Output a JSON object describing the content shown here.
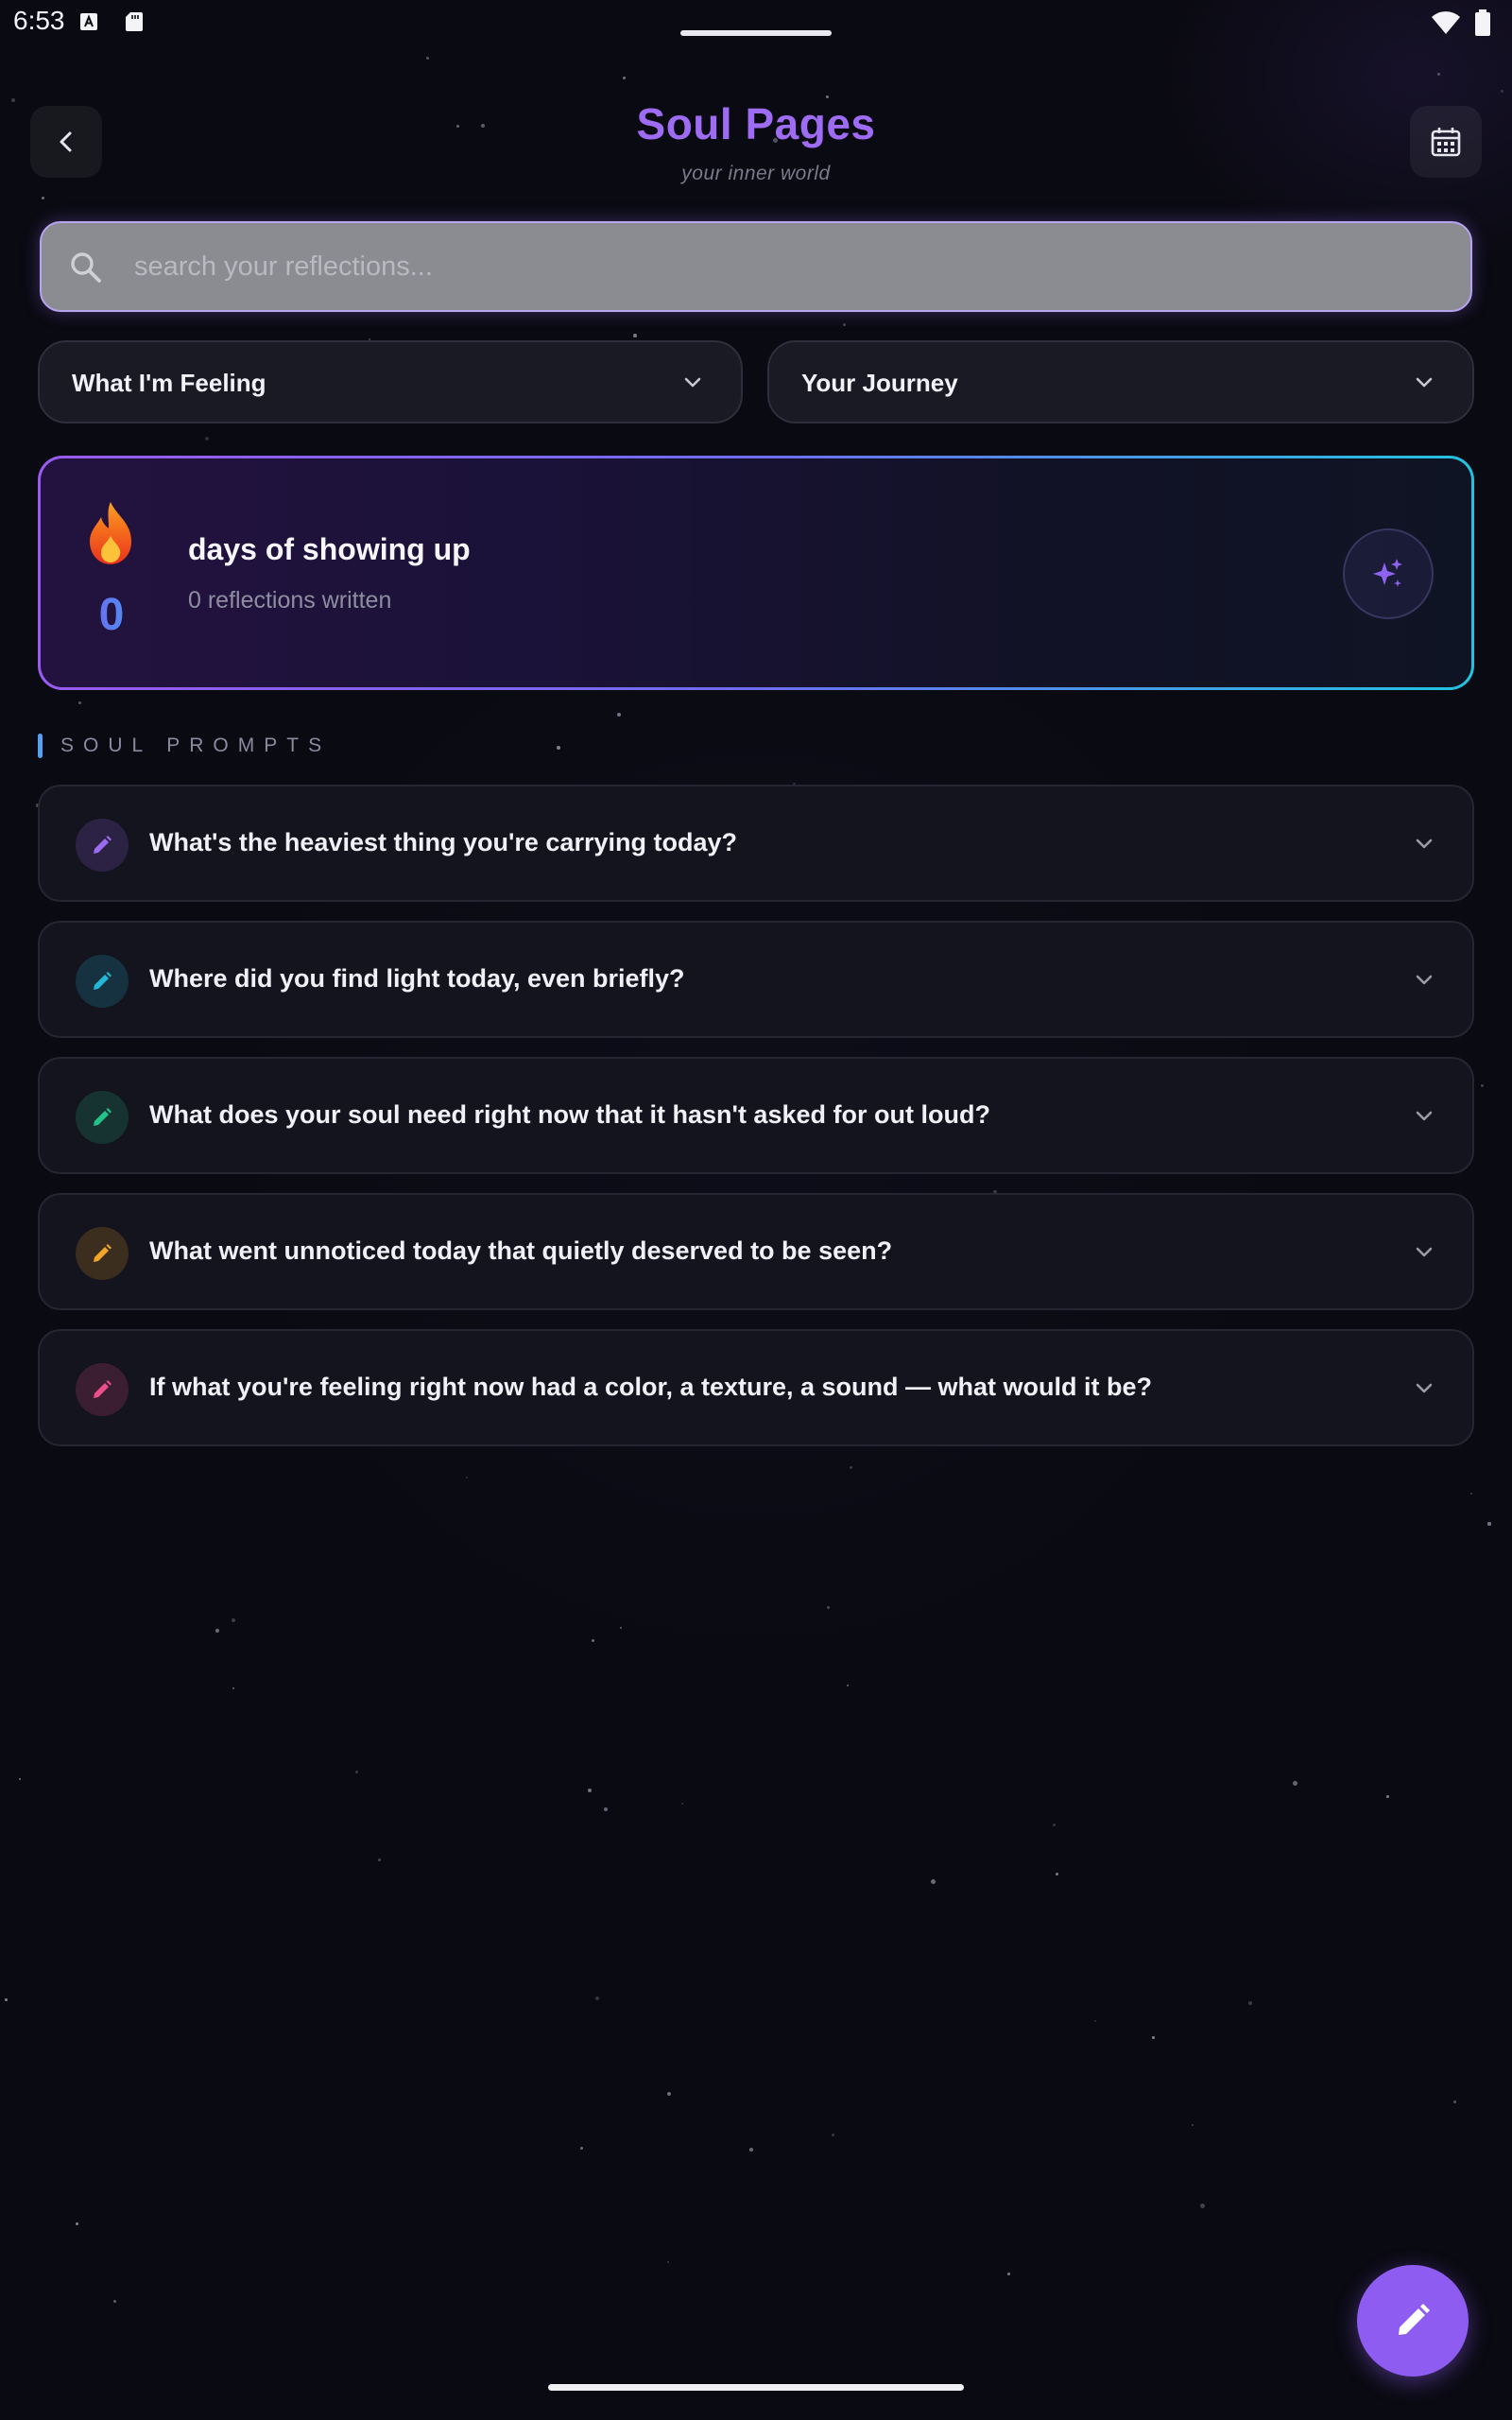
{
  "status_bar": {
    "time": "6:53"
  },
  "header": {
    "title": "Soul Pages",
    "subtitle": "your inner world",
    "back_icon": "chevron-left-icon",
    "calendar_icon": "calendar-icon"
  },
  "search": {
    "placeholder": "search your reflections...",
    "value": ""
  },
  "filters": {
    "feeling_label": "What I'm Feeling",
    "journey_label": "Your Journey"
  },
  "streak": {
    "count": "0",
    "title": "days of showing up",
    "subtitle": "0 reflections written",
    "icon": "flame-icon",
    "action_icon": "sparkles-icon"
  },
  "section": {
    "label": "SOUL PROMPTS"
  },
  "prompts": [
    {
      "text": "What's the heaviest thing you're carrying today?",
      "color": "#9b6cf2"
    },
    {
      "text": "Where did you find light today, even briefly?",
      "color": "#22b8d6"
    },
    {
      "text": "What does your soul need right now that it hasn't asked for out loud?",
      "color": "#22c48a"
    },
    {
      "text": "What went unnoticed today that quietly deserved to be seen?",
      "color": "#f2a526"
    },
    {
      "text": "If what you're feeling right now had a color, a texture, a sound — what would it be?",
      "color": "#ec4f8c"
    }
  ],
  "fab": {
    "icon": "pencil-icon"
  },
  "colors": {
    "accent": "#9b6cf2",
    "background": "#0a0a12",
    "streak_gradient_start": "#9a5cf0",
    "streak_gradient_end": "#22c3de"
  }
}
